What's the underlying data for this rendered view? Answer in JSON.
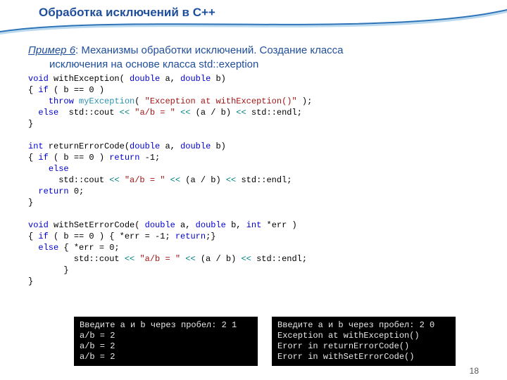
{
  "header": {
    "title": "Обработка исключений в С++"
  },
  "subtitle": {
    "label": "Пример 6",
    "text1": ": Механизмы обработки исключений. Создание класса",
    "text2": "исключения на основе класса std::exeption"
  },
  "code": {
    "l1a": "void",
    "l1b": " withException( ",
    "l1c": "double",
    "l1d": " a, ",
    "l1e": "double",
    "l1f": " b)",
    "l2a": "{ ",
    "l2b": "if",
    "l2c": " ( b == 0 )",
    "l3a": "    ",
    "l3b": "throw",
    "l3c": " ",
    "l3d": "myException",
    "l3e": "( ",
    "l3f": "\"Exception at withException()\"",
    "l3g": " );",
    "l4a": "  ",
    "l4b": "else",
    "l4c": "  std::cout ",
    "l4d": "<<",
    "l4e": " ",
    "l4f": "\"a/b = \"",
    "l4g": " ",
    "l4h": "<<",
    "l4i": " (a / b) ",
    "l4j": "<<",
    "l4k": " std::endl;",
    "l5": "}",
    "l7a": "int",
    "l7b": " returnErrorCode(",
    "l7c": "double",
    "l7d": " a, ",
    "l7e": "double",
    "l7f": " b)",
    "l8a": "{ ",
    "l8b": "if",
    "l8c": " ( b == 0 ) ",
    "l8d": "return",
    "l8e": " -1;",
    "l9a": "    ",
    "l9b": "else",
    "l10a": "      std::cout ",
    "l10b": "<<",
    "l10c": " ",
    "l10d": "\"a/b = \"",
    "l10e": " ",
    "l10f": "<<",
    "l10g": " (a / b) ",
    "l10h": "<<",
    "l10i": " std::endl;",
    "l11a": "  ",
    "l11b": "return",
    "l11c": " 0;",
    "l12": "}",
    "l14a": "void",
    "l14b": " withSetErrorCode( ",
    "l14c": "double",
    "l14d": " a, ",
    "l14e": "double",
    "l14f": " b, ",
    "l14g": "int",
    "l14h": " *err )",
    "l15a": "{ ",
    "l15b": "if",
    "l15c": " ( b == 0 ) { *err = -1; ",
    "l15d": "return",
    "l15e": ";}",
    "l16a": "  ",
    "l16b": "else",
    "l16c": " { *err = 0;",
    "l17a": "         std::cout ",
    "l17b": "<<",
    "l17c": " ",
    "l17d": "\"a/b = \"",
    "l17e": " ",
    "l17f": "<<",
    "l17g": " (a / b) ",
    "l17h": "<<",
    "l17i": " std::endl;",
    "l18": "       }",
    "l19": "}"
  },
  "console1": {
    "line1": "Введите a и b через пробел: 2 1",
    "line2": "a/b = 2",
    "line3": "a/b = 2",
    "line4": "a/b = 2"
  },
  "console2": {
    "line1": "Введите a и b через пробел: 2 0",
    "line2": "Exception at withException()",
    "line3": "Erorr in returnErrorCode()",
    "line4": "Erorr in withSetErrorCode()"
  },
  "page": "18"
}
